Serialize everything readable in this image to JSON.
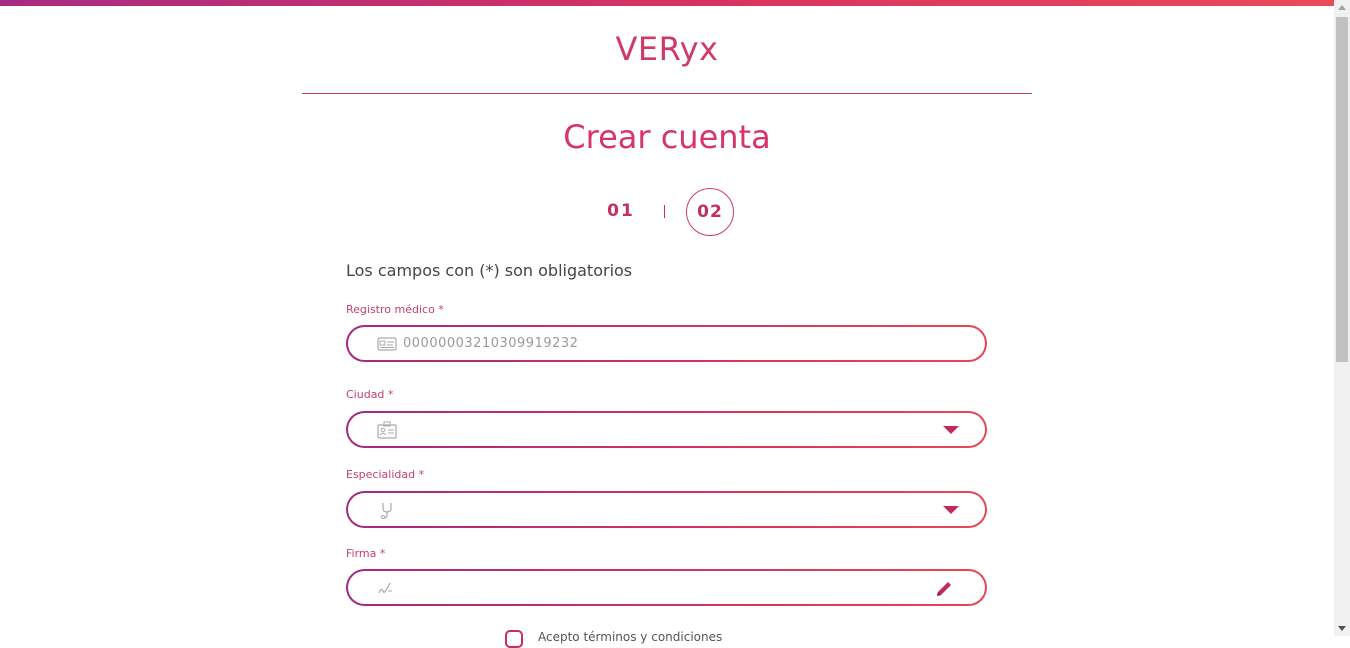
{
  "brand": {
    "name": "VERyx"
  },
  "page": {
    "title": "Crear cuenta"
  },
  "steps": [
    {
      "label": "01",
      "active": false
    },
    {
      "label": "02",
      "active": true
    }
  ],
  "form": {
    "required_note": "Los campos con (*) son obligatorios",
    "fields": [
      {
        "label": "Registro médico *",
        "value": "0000000321030991923​2",
        "icon": "id-card-icon",
        "type": "text"
      },
      {
        "label": "Ciudad *",
        "value": "",
        "icon": "building-badge-icon",
        "type": "select"
      },
      {
        "label": "Especialidad *",
        "value": "",
        "icon": "stethoscope-icon",
        "type": "select"
      },
      {
        "label": "Firma *",
        "value": "",
        "icon": "signature-icon",
        "type": "signature"
      }
    ],
    "terms": {
      "label": "Acepto términos y condiciones",
      "checked": false
    }
  },
  "colors": {
    "accent": "#d13a67",
    "gradient_start": "#a32982",
    "gradient_end": "#e84656"
  }
}
